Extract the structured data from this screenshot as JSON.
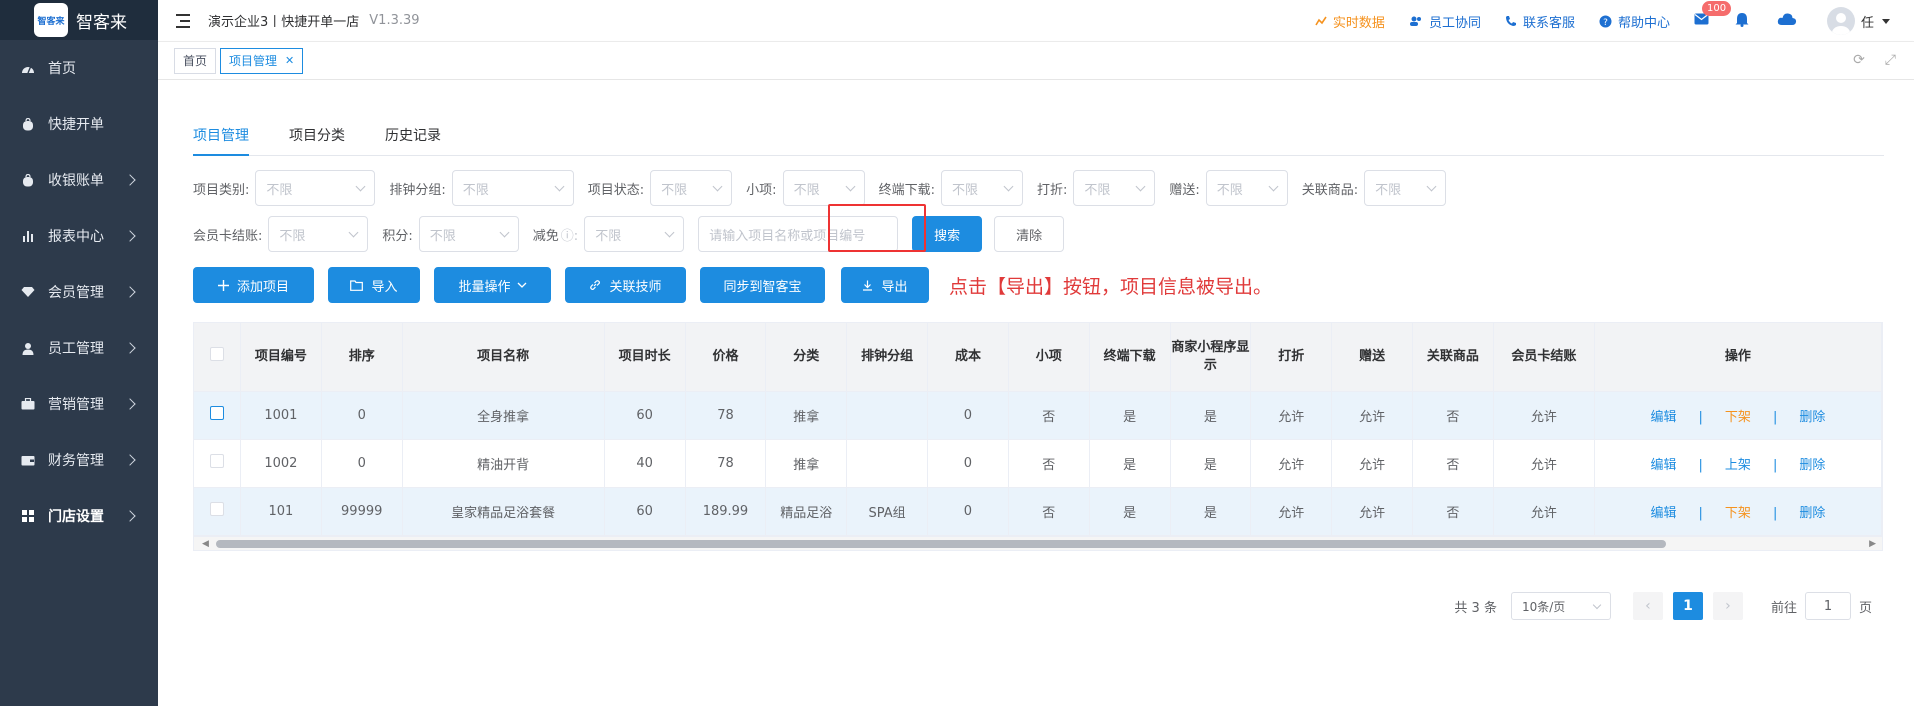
{
  "brand": {
    "logo_text": "智客来",
    "logo_mark": "智客来"
  },
  "sidebar": {
    "items": [
      {
        "label": "首页",
        "icon": "dashboard-icon",
        "arrow": false
      },
      {
        "label": "快捷开单",
        "icon": "bag-icon",
        "arrow": false
      },
      {
        "label": "收银账单",
        "icon": "bag-icon",
        "arrow": true
      },
      {
        "label": "报表中心",
        "icon": "bar-chart-icon",
        "arrow": true
      },
      {
        "label": "会员管理",
        "icon": "diamond-icon",
        "arrow": true
      },
      {
        "label": "员工管理",
        "icon": "user-icon",
        "arrow": true
      },
      {
        "label": "营销管理",
        "icon": "briefcase-icon",
        "arrow": true
      },
      {
        "label": "财务管理",
        "icon": "wallet-icon",
        "arrow": true
      },
      {
        "label": "门店设置",
        "icon": "grid-icon",
        "arrow": true
      }
    ]
  },
  "header": {
    "business": "演示企业3丨快捷开单一店",
    "version": "V1.3.39",
    "links": {
      "realtime": "实时数据",
      "staff": "员工协同",
      "service": "联系客服",
      "help": "帮助中心"
    },
    "mail_badge": "100",
    "user": "任"
  },
  "tagbar": {
    "home": "首页",
    "current": "项目管理"
  },
  "tabs": [
    "项目管理",
    "项目分类",
    "历史记录"
  ],
  "filters": {
    "row1": [
      {
        "label": "项目类别:",
        "value": "不限"
      },
      {
        "label": "排钟分组:",
        "value": "不限"
      },
      {
        "label": "项目状态:",
        "value": "不限"
      },
      {
        "label": "小项:",
        "value": "不限"
      },
      {
        "label": "终端下载:",
        "value": "不限"
      },
      {
        "label": "打折:",
        "value": "不限"
      },
      {
        "label": "赠送:",
        "value": "不限"
      },
      {
        "label": "关联商品:",
        "value": "不限"
      }
    ],
    "row2": [
      {
        "label": "会员卡结账:",
        "value": "不限"
      },
      {
        "label": "积分:",
        "value": "不限"
      },
      {
        "label": "减免",
        "value": "不限"
      }
    ],
    "search_placeholder": "请输入项目名称或项目编号",
    "search_btn": "搜索",
    "clear_btn": "清除"
  },
  "actions": {
    "add": "添加项目",
    "import": "导入",
    "batch": "批量操作",
    "link_tech": "关联技师",
    "sync": "同步到智客宝",
    "export": "导出",
    "note": "点击【导出】按钮，项目信息被导出。"
  },
  "table": {
    "columns": [
      "项目编号",
      "排序",
      "项目名称",
      "项目时长",
      "价格",
      "分类",
      "排钟分组",
      "成本",
      "小项",
      "终端下载",
      "商家小程序显示",
      "打折",
      "赠送",
      "关联商品",
      "会员卡结账",
      "操作"
    ],
    "rows": [
      {
        "code": "1001",
        "sort": "0",
        "name": "全身推拿",
        "duration": "60",
        "price": "78",
        "cat": "推拿",
        "group": "",
        "cost": "0",
        "small": "否",
        "download": "是",
        "mini": "是",
        "discount": "允许",
        "gift": "允许",
        "linked": "否",
        "card": "允许",
        "ops": [
          "编辑",
          "下架",
          "删除"
        ]
      },
      {
        "code": "1002",
        "sort": "0",
        "name": "精油开背",
        "duration": "40",
        "price": "78",
        "cat": "推拿",
        "group": "",
        "cost": "0",
        "small": "否",
        "download": "是",
        "mini": "是",
        "discount": "允许",
        "gift": "允许",
        "linked": "否",
        "card": "允许",
        "ops": [
          "编辑",
          "上架",
          "删除"
        ]
      },
      {
        "code": "101",
        "sort": "99999",
        "name": "皇家精品足浴套餐",
        "duration": "60",
        "price": "189.99",
        "cat": "精品足浴",
        "group": "SPA组",
        "cost": "0",
        "small": "否",
        "download": "是",
        "mini": "是",
        "discount": "允许",
        "gift": "允许",
        "linked": "否",
        "card": "允许",
        "ops": [
          "编辑",
          "下架",
          "删除"
        ]
      }
    ]
  },
  "pager": {
    "total": "共 3 条",
    "size": "10条/页",
    "current": "1",
    "goto_label": "前往",
    "goto_value": "1",
    "page_unit": "页"
  },
  "colors": {
    "sidebar": "#2d3a4b",
    "primary": "#1d8ce0",
    "orange": "#f5921e",
    "highlight": "#e33333"
  }
}
